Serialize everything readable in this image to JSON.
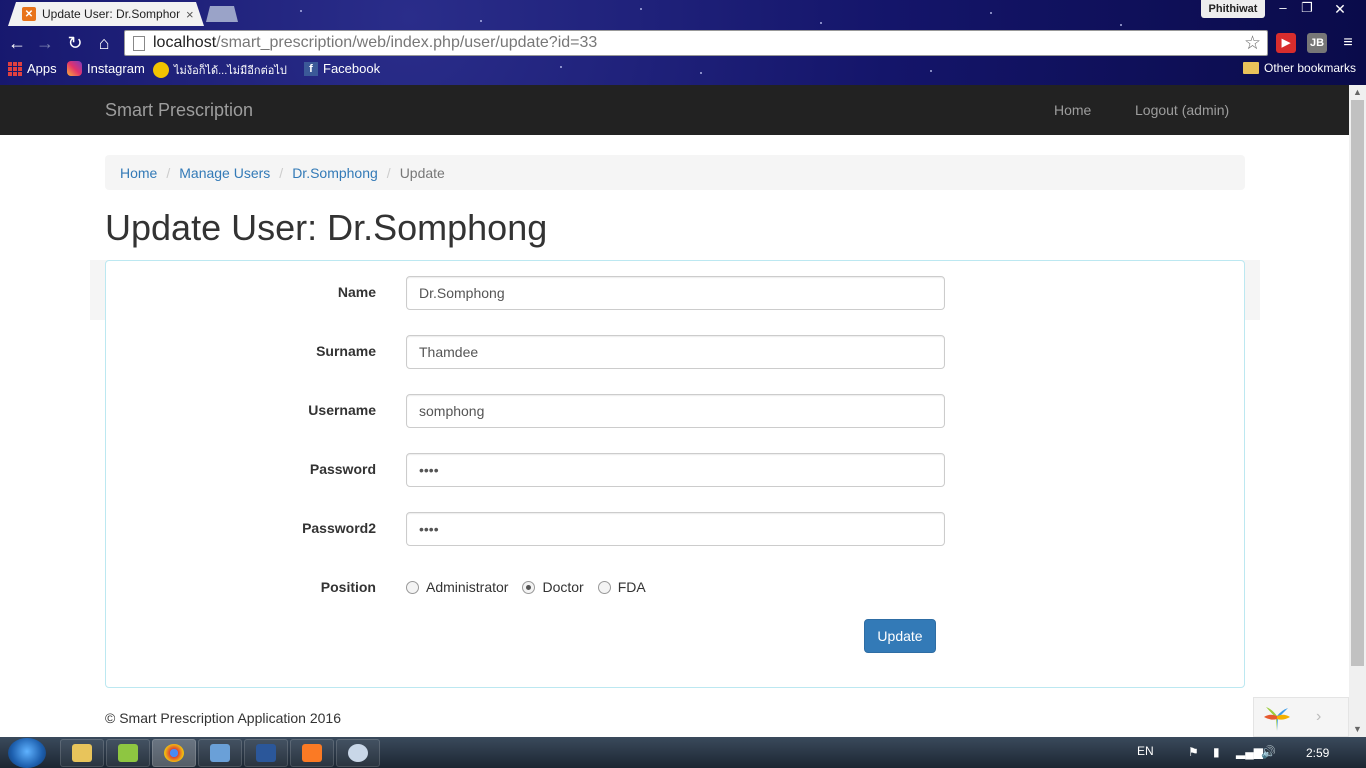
{
  "browser": {
    "tab_title": "Update User: Dr.Somphong",
    "tab_close": "×",
    "profile": "Phithiwat",
    "url_host": "localhost",
    "url_rest": "/smart_prescription/web/index.php/user/update?id=33",
    "bookmarks": {
      "apps": "Apps",
      "instagram": "Instagram",
      "thai": "ไม่ง้อก็ได้...ไม่มีอีกต่อไป",
      "facebook": "Facebook",
      "other": "Other bookmarks"
    }
  },
  "navbar": {
    "brand": "Smart Prescription",
    "home": "Home",
    "logout": "Logout (admin)"
  },
  "breadcrumb": {
    "home": "Home",
    "manage": "Manage Users",
    "user": "Dr.Somphong",
    "current": "Update",
    "separator": "/"
  },
  "page_title": "Update User: Dr.Somphong",
  "form": {
    "name_label": "Name",
    "name_value": "Dr.Somphong",
    "surname_label": "Surname",
    "surname_value": "Thamdee",
    "username_label": "Username",
    "username_value": "somphong",
    "password_label": "Password",
    "password_value": "••••",
    "password2_label": "Password2",
    "password2_value": "••••",
    "position_label": "Position",
    "positions": [
      "Administrator",
      "Doctor",
      "FDA"
    ],
    "selected_position": "Doctor",
    "submit": "Update"
  },
  "footer": "© Smart Prescription Application 2016",
  "taskbar": {
    "lang": "EN",
    "time": "2:59"
  },
  "colors": {
    "navbar": "#222222",
    "link": "#337ab7",
    "primary": "#337ab7",
    "panel_border": "#bce8f1"
  }
}
